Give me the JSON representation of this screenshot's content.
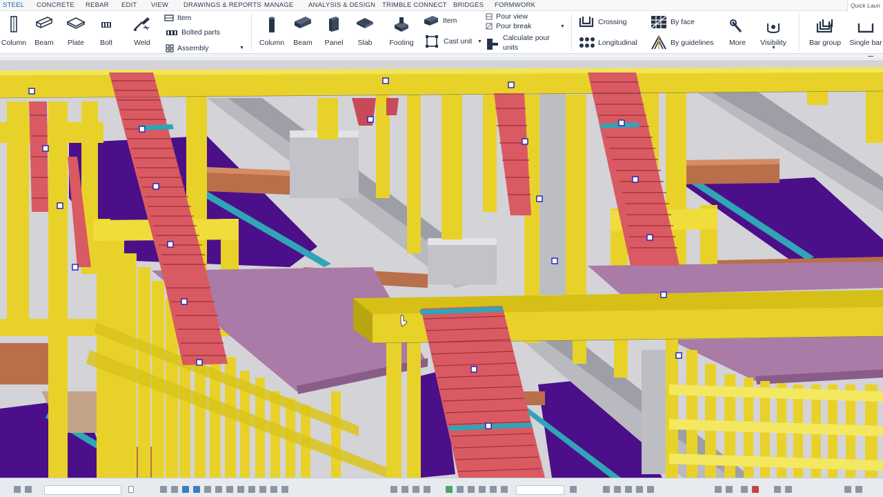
{
  "ribbon_tabs": [
    {
      "label": "STEEL",
      "active": true
    },
    {
      "label": "CONCRETE",
      "active": false
    },
    {
      "label": "REBAR",
      "active": false
    },
    {
      "label": "EDIT",
      "active": false
    },
    {
      "label": "VIEW",
      "active": false
    },
    {
      "label": "DRAWINGS & REPORTS",
      "active": false
    },
    {
      "label": "MANAGE",
      "active": false
    },
    {
      "label": "ANALYSIS & DESIGN",
      "active": false
    },
    {
      "label": "TRIMBLE CONNECT",
      "active": false
    },
    {
      "label": "BRIDGES",
      "active": false
    },
    {
      "label": "FORMWORK",
      "active": false
    }
  ],
  "quick_launch": {
    "label": "Quick Laun"
  },
  "steel": {
    "column": "Column",
    "beam": "Beam",
    "plate": "Plate",
    "bolt": "Bolt",
    "weld": "Weld",
    "item": "Item",
    "bolted_parts": "Bolted parts",
    "assembly": "Assembly"
  },
  "concrete": {
    "column": "Column",
    "beam": "Beam",
    "panel": "Panel",
    "slab": "Slab",
    "footing": "Footing",
    "item": "Item",
    "cast_unit": "Cast unit",
    "pour_view": "Pour view",
    "pour_break": "Pour break",
    "calculate_line1": "Calculate pour",
    "calculate_line2": "units"
  },
  "rebar": {
    "crossing": "Crossing",
    "longitudinal": "Longitudinal",
    "by_face": "By face",
    "by_guidelines": "By guidelines",
    "more": "More",
    "visibility": "Visibility",
    "bar_group": "Bar group",
    "single_bar": "Single bar"
  },
  "colors": {
    "accent": "#0b63b5",
    "steel_yellow": "#e8d22a",
    "stair_red": "#d95a62",
    "slab_purple": "#a97ba6",
    "deep_purple": "#4b0f8a",
    "concrete_gray": "#c9c9cf",
    "timber_brown": "#b86f4a",
    "teal_edge": "#2fa5b6"
  }
}
